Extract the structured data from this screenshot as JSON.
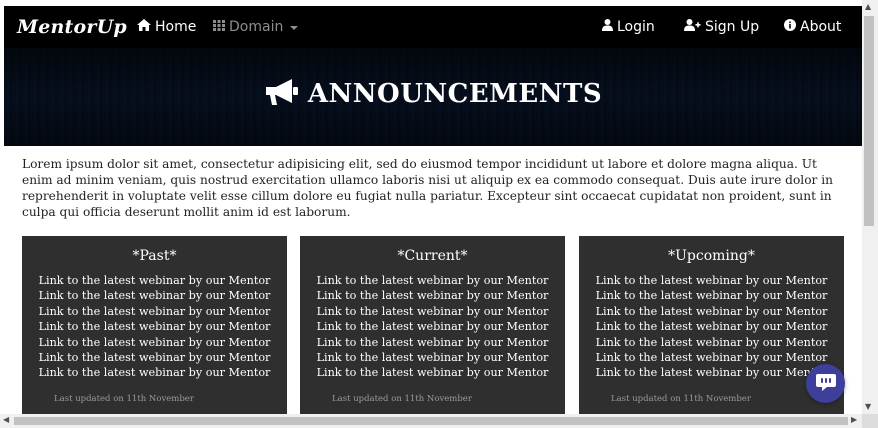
{
  "navbar": {
    "brand": "MentorUp",
    "items": [
      {
        "label": "Home",
        "icon": "home-icon"
      },
      {
        "label": "Domain",
        "icon": "grid-icon"
      },
      {
        "label": "Login",
        "icon": "user-icon"
      },
      {
        "label": "Sign Up",
        "icon": "user-plus-icon"
      },
      {
        "label": "About",
        "icon": "info-icon"
      }
    ]
  },
  "banner": {
    "title": "ANNOUNCEMENTS",
    "icon": "megaphone-icon"
  },
  "intro": "Lorem ipsum dolor sit amet, consectetur adipisicing elit, sed do eiusmod tempor incididunt ut labore et dolore magna aliqua. Ut enim ad minim veniam, quis nostrud exercitation ullamco laboris nisi ut aliquip ex ea commodo consequat. Duis aute irure dolor in reprehenderit in voluptate velit esse cillum dolore eu fugiat nulla pariatur. Excepteur sint occaecat cupidatat non proident, sunt in culpa qui officia deserunt mollit anim id est laborum.",
  "cards": [
    {
      "title": "*Past*",
      "links": [
        "Link to the latest webinar by our Mentor",
        "Link to the latest webinar by our Mentor",
        "Link to the latest webinar by our Mentor",
        "Link to the latest webinar by our Mentor",
        "Link to the latest webinar by our Mentor",
        "Link to the latest webinar by our Mentor",
        "Link to the latest webinar by our Mentor"
      ],
      "updated": "Last updated on 11th November"
    },
    {
      "title": "*Current*",
      "links": [
        "Link to the latest webinar by our Mentor",
        "Link to the latest webinar by our Mentor",
        "Link to the latest webinar by our Mentor",
        "Link to the latest webinar by our Mentor",
        "Link to the latest webinar by our Mentor",
        "Link to the latest webinar by our Mentor",
        "Link to the latest webinar by our Mentor"
      ],
      "updated": "Last updated on 11th November"
    },
    {
      "title": "*Upcoming*",
      "links": [
        "Link to the latest webinar by our Mentor",
        "Link to the latest webinar by our Mentor",
        "Link to the latest webinar by our Mentor",
        "Link to the latest webinar by our Mentor",
        "Link to the latest webinar by our Mentor",
        "Link to the latest webinar by our Mentor",
        "Link to the latest webinar by our Mentor"
      ],
      "updated": "Last updated on 11th November"
    }
  ],
  "chat": {
    "icon": "chat-bubble-icon"
  },
  "colors": {
    "navbar": "#000000",
    "card": "#2f2f2f",
    "chat_button": "#3d3f9a",
    "nav_muted": "#8d8d8d"
  }
}
